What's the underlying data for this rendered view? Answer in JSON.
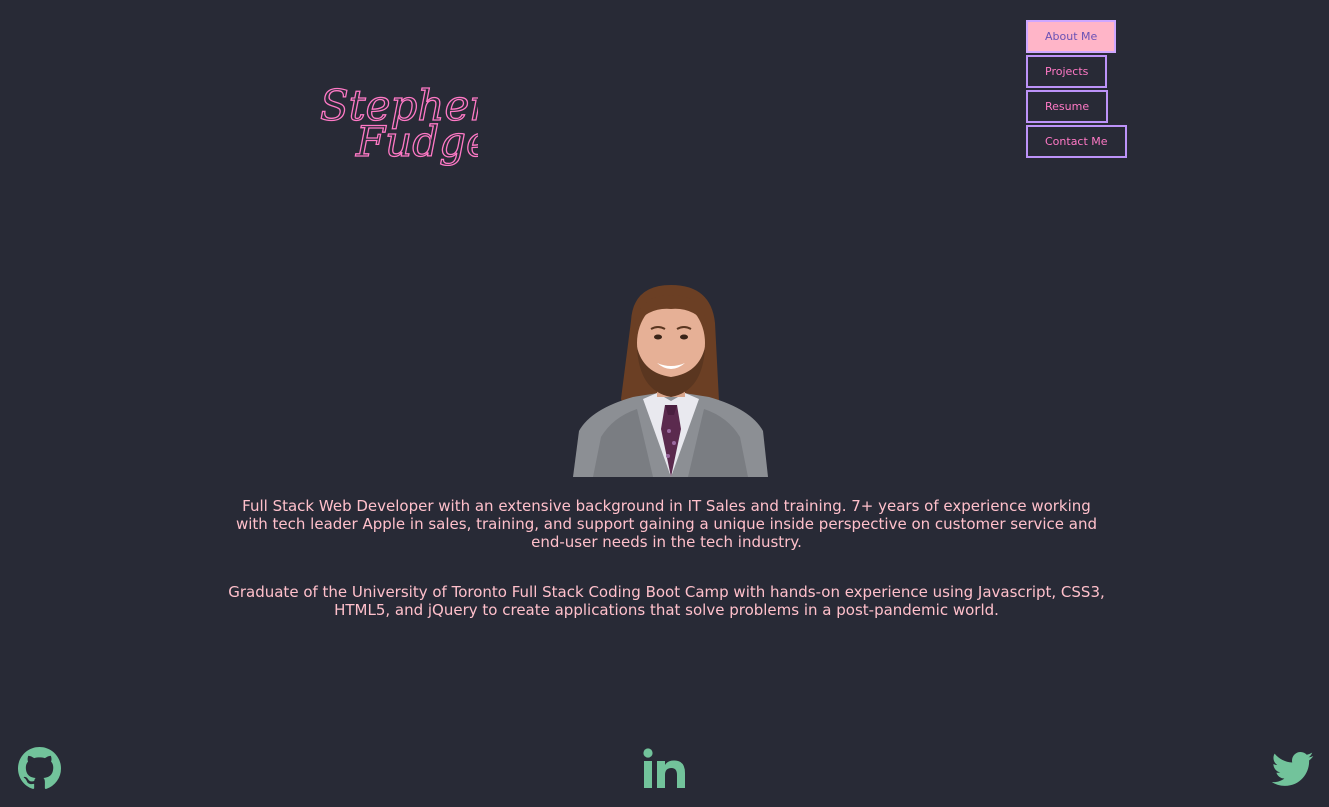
{
  "logo": {
    "line1": "Stephen",
    "line2": "Fudge",
    "color": "#ff79c6"
  },
  "nav": {
    "items": [
      {
        "label": "About Me",
        "active": true
      },
      {
        "label": "Projects",
        "active": false
      },
      {
        "label": "Resume",
        "active": false
      },
      {
        "label": "Contact Me",
        "active": false
      }
    ]
  },
  "profile": {
    "photo_icon": "portrait-photo"
  },
  "bio": {
    "paragraph1": "Full Stack Web Developer with an extensive background in IT Sales and training. 7+ years of experience working with tech leader Apple in sales, training, and support gaining a unique inside perspective on customer service and end-user needs in the tech industry.",
    "paragraph2": "Graduate of the University of Toronto Full Stack Coding Boot Camp with hands-on experience using Javascript, CSS3, HTML5, and jQuery to create applications that solve problems in a post-pandemic world."
  },
  "social": {
    "icons": [
      "github-icon",
      "linkedin-icon",
      "twitter-icon"
    ],
    "color": "#72c39b"
  },
  "colors": {
    "background": "#282a36",
    "accent_pink": "#ff79c6",
    "border_purple": "#bd93f9",
    "text": "#ffc0cb"
  }
}
